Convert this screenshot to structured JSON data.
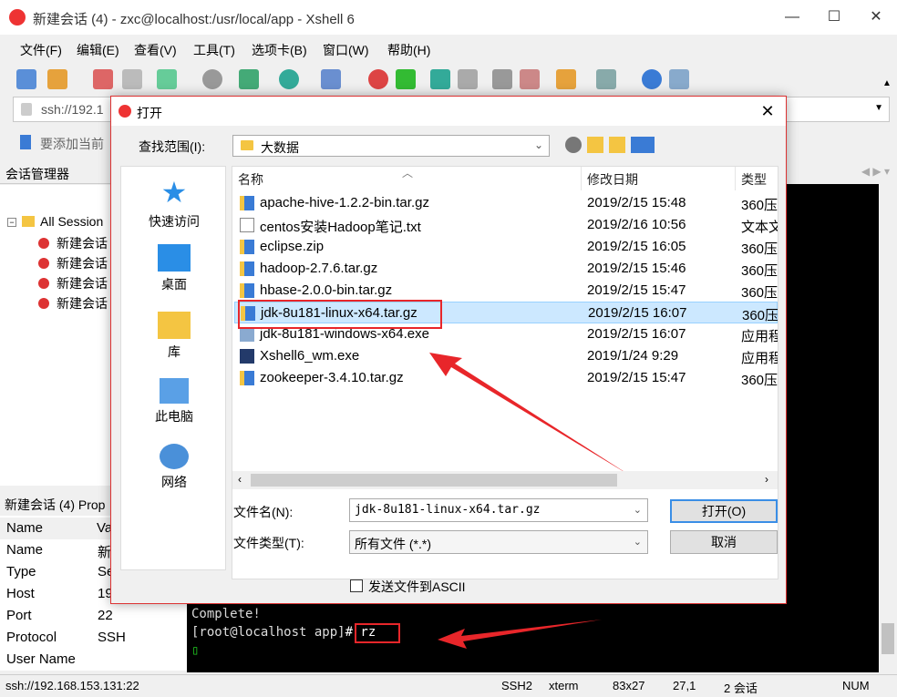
{
  "window": {
    "title": "新建会话 (4) - zxc@localhost:/usr/local/app - Xshell 6",
    "min_label": "—",
    "max_label": "☐",
    "close_label": "✕"
  },
  "menu": [
    "文件(F)",
    "编辑(E)",
    "查看(V)",
    "工具(T)",
    "选项卡(B)",
    "窗口(W)",
    "帮助(H)"
  ],
  "address_bar": {
    "text": "ssh://192.1"
  },
  "bookmark_bar": {
    "text": "要添加当前"
  },
  "session_manager": {
    "title": "会话管理器",
    "root": "All Session",
    "items": [
      "新建会话",
      "新建会话",
      "新建会话",
      "新建会话"
    ]
  },
  "properties": {
    "title": "新建会话 (4) Prop",
    "col_name": "Name",
    "col_value": "Va",
    "rows": [
      {
        "name": "Name",
        "value": "新"
      },
      {
        "name": "Type",
        "value": "Se"
      },
      {
        "name": "Host",
        "value": "19"
      },
      {
        "name": "Port",
        "value": "22"
      },
      {
        "name": "Protocol",
        "value": "SSH"
      },
      {
        "name": "User Name",
        "value": ""
      }
    ]
  },
  "terminal": {
    "lines": [
      "Complete!",
      "[root@localhost app]"
    ],
    "prompt_cmd": "# rz",
    "cursor": "▯"
  },
  "statusbar": {
    "url": "ssh://192.168.153.131:22",
    "protocol": "SSH2",
    "term": "xterm",
    "size": "83x27",
    "pos": "27,1",
    "sessions": "2 会话",
    "num": "NUM"
  },
  "dialog": {
    "title": "打开",
    "close": "✕",
    "lookin_label": "查找范围(I):",
    "lookin_value": "大数据",
    "places": [
      "快速访问",
      "桌面",
      "库",
      "此电脑",
      "网络"
    ],
    "columns": {
      "name": "名称",
      "date": "修改日期",
      "type": "类型"
    },
    "files": [
      {
        "name": "apache-hive-1.2.2-bin.tar.gz",
        "date": "2019/2/15 15:48",
        "type": "360压",
        "icon": "archive-icon"
      },
      {
        "name": "centos安装Hadoop笔记.txt",
        "date": "2019/2/16 10:56",
        "type": "文本文",
        "icon": "text-file-icon"
      },
      {
        "name": "eclipse.zip",
        "date": "2019/2/15 16:05",
        "type": "360压",
        "icon": "archive-icon"
      },
      {
        "name": "hadoop-2.7.6.tar.gz",
        "date": "2019/2/15 15:46",
        "type": "360压",
        "icon": "archive-icon"
      },
      {
        "name": "hbase-2.0.0-bin.tar.gz",
        "date": "2019/2/15 15:47",
        "type": "360压",
        "icon": "archive-icon"
      },
      {
        "name": "jdk-8u181-linux-x64.tar.gz",
        "date": "2019/2/15 16:07",
        "type": "360压",
        "icon": "archive-icon",
        "selected": true
      },
      {
        "name": "jdk-8u181-windows-x64.exe",
        "date": "2019/2/15 16:07",
        "type": "应用程",
        "icon": "installer-icon"
      },
      {
        "name": "Xshell6_wm.exe",
        "date": "2019/1/24 9:29",
        "type": "应用程",
        "icon": "exe-icon"
      },
      {
        "name": "zookeeper-3.4.10.tar.gz",
        "date": "2019/2/15 15:47",
        "type": "360压",
        "icon": "archive-icon"
      }
    ],
    "filename_label": "文件名(N):",
    "filename_value": "jdk-8u181-linux-x64.tar.gz",
    "filetype_label": "文件类型(T):",
    "filetype_value": "所有文件 (*.*)",
    "open_button": "打开(O)",
    "cancel_button": "取消",
    "ascii_label": "发送文件到ASCII"
  },
  "colors": {
    "accent": "#3a8ee6",
    "highlight": "#e8262a",
    "selection": "#cce8ff"
  }
}
